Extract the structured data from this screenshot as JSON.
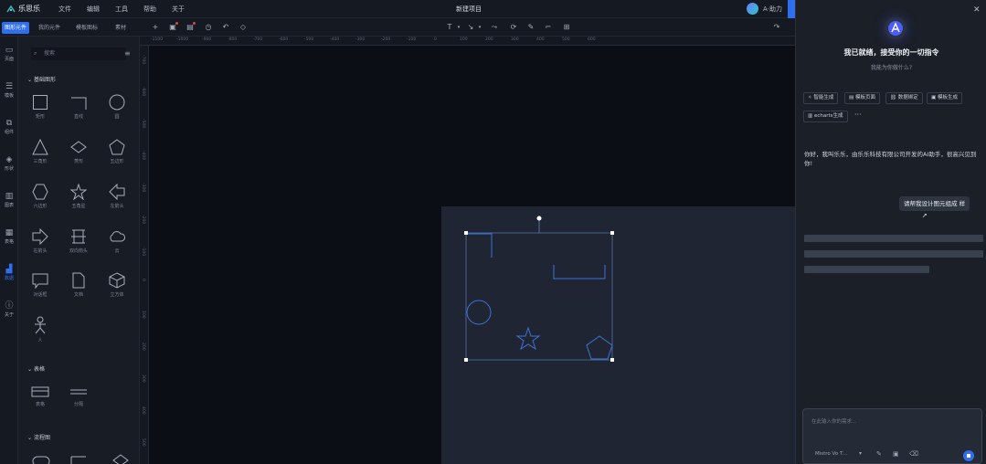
{
  "app": {
    "logo_text": "乐思乐",
    "document_title": "新建项目",
    "user_name": "A·助力"
  },
  "menu": [
    "文件",
    "编辑",
    "工具",
    "帮助",
    "关于"
  ],
  "toolbar": {
    "tabs": [
      {
        "label": "图形元件"
      },
      {
        "label": "我的元件"
      },
      {
        "label": "模板图标"
      },
      {
        "label": "素材"
      }
    ],
    "text_tool": "T",
    "line_tool": "↘"
  },
  "left_rail": [
    {
      "icon": "monitor-icon",
      "label": "页面"
    },
    {
      "icon": "list-icon",
      "label": "模板"
    },
    {
      "icon": "component-icon",
      "label": "组件"
    },
    {
      "icon": "cube-icon",
      "label": "形状"
    },
    {
      "icon": "chart-icon",
      "label": "图表"
    },
    {
      "icon": "table-icon",
      "label": "表格"
    },
    {
      "icon": "data-icon",
      "label": "数据"
    },
    {
      "icon": "info-icon",
      "label": "关于"
    }
  ],
  "shape_panel": {
    "search_placeholder": "搜索",
    "sections": [
      {
        "title": "基础图形",
        "items": [
          "矩形",
          "直线",
          "圆",
          "三角形",
          "菱形",
          "五边形",
          "六边形",
          "五角星",
          "左箭头",
          "右箭头",
          "双向箭头",
          "云",
          "对话框",
          "文档",
          "立方体",
          "人"
        ]
      },
      {
        "title": "表格",
        "items": [
          "表格",
          "分隔"
        ]
      },
      {
        "title": "流程图",
        "items": []
      }
    ]
  },
  "ruler": {
    "top": [
      "-1100",
      "-1000",
      "-900",
      "-800",
      "-700",
      "-600",
      "-500",
      "-400",
      "-300",
      "-200",
      "-100",
      "0",
      "100",
      "200",
      "300",
      "400",
      "500",
      "600"
    ],
    "left": [
      "-700",
      "-600",
      "-500",
      "-400",
      "-300",
      "-200",
      "-100",
      "0",
      "100",
      "200",
      "300",
      "400",
      "500"
    ]
  },
  "assistant": {
    "title": "我已就绪，接受你的一切指令",
    "subtitle": "我能为你做什么?",
    "chips": [
      "智能生成",
      "模板页面",
      "数据绑定",
      "模板生成",
      "echarts生成",
      "···"
    ],
    "message": "你好，我叫乐乐，由乐乐科技有限公司开发的AI助手，很高兴见到你!",
    "user_message": "请帮我设计图元组成 样",
    "composer_placeholder": "在此输入你的需求...",
    "model_label": "Mistro Vo T...",
    "send_icon": "send-icon"
  }
}
